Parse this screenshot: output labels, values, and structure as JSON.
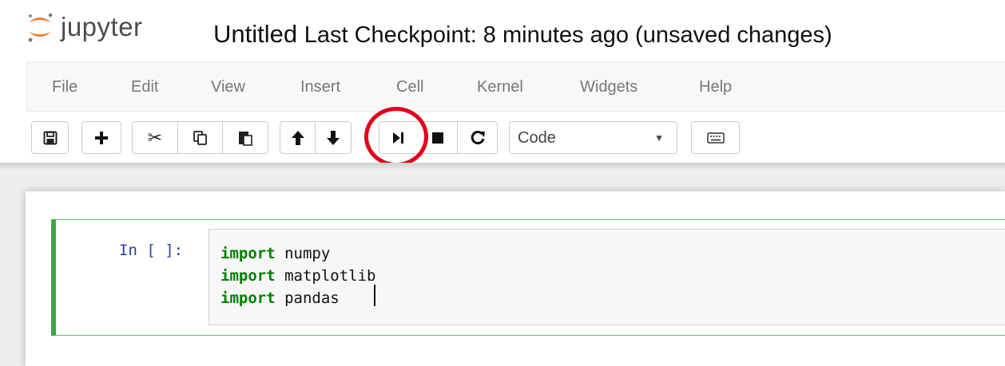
{
  "header": {
    "logo_text": "jupyter",
    "notebook_name": "Untitled",
    "checkpoint": "Last Checkpoint: 8 minutes ago (unsaved changes)"
  },
  "menu": {
    "items": [
      "File",
      "Edit",
      "View",
      "Insert",
      "Cell",
      "Kernel",
      "Widgets",
      "Help"
    ]
  },
  "toolbar": {
    "icons": [
      "save-icon",
      "plus-icon",
      "scissors-icon",
      "copy-icon",
      "paste-icon",
      "arrow-up-icon",
      "arrow-down-icon",
      "run-icon",
      "stop-icon",
      "restart-icon",
      "keyboard-icon"
    ],
    "cell_type": "Code",
    "highlight_color": "#e0001a"
  },
  "cell": {
    "prompt": "In [ ]:",
    "lines": [
      {
        "keyword": "import",
        "rest": " numpy"
      },
      {
        "keyword": "import",
        "rest": " matplotlib"
      },
      {
        "keyword": "import",
        "rest": " pandas"
      }
    ],
    "border_color": "#42a547"
  },
  "colors": {
    "keyword": "#008000",
    "prompt": "#303f9f",
    "logo_orange": "#f37726"
  }
}
